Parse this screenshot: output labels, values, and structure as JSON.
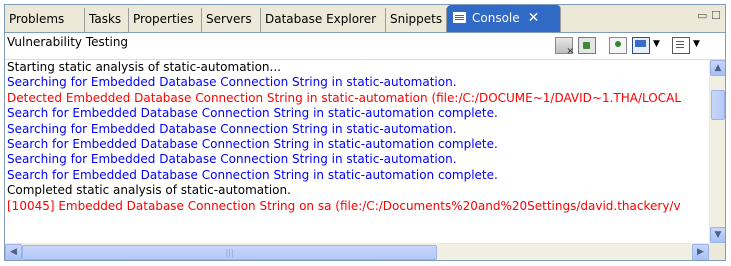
{
  "tabs": [
    {
      "label": "Problems"
    },
    {
      "label": "Tasks"
    },
    {
      "label": "Properties"
    },
    {
      "label": "Servers"
    },
    {
      "label": "Database Explorer"
    },
    {
      "label": "Snippets"
    },
    {
      "label": "Console",
      "active": true
    }
  ],
  "window_controls": {
    "minimize": "▭",
    "maximize": "☐"
  },
  "console_title": "Vulnerability Testing",
  "toolbar_icons": [
    "clear-console-icon",
    "scroll-lock-icon",
    "pin-console-icon",
    "display-console-icon",
    "open-console-icon"
  ],
  "colors": {
    "normal": "#000000",
    "info": "#0000ff",
    "error": "#ff0000",
    "accent": "#3169c6"
  },
  "lines": [
    {
      "text": "Starting static analysis of static-automation...",
      "color": "black"
    },
    {
      "text": "Searching for Embedded Database Connection String in static-automation.",
      "color": "blue"
    },
    {
      "text": "Detected Embedded Database Connection String in static-automation (file:/C:/DOCUME~1/DAVID~1.THA/LOCAL",
      "color": "red"
    },
    {
      "text": "Search for Embedded Database Connection String in static-automation complete.",
      "color": "blue"
    },
    {
      "text": "Searching for Embedded Database Connection String in static-automation.",
      "color": "blue"
    },
    {
      "text": "Search for Embedded Database Connection String in static-automation complete.",
      "color": "blue"
    },
    {
      "text": "Searching for Embedded Database Connection String in static-automation.",
      "color": "blue"
    },
    {
      "text": "Search for Embedded Database Connection String in static-automation complete.",
      "color": "blue"
    },
    {
      "text": "Completed static analysis of static-automation.",
      "color": "black"
    },
    {
      "text": "[10045] Embedded Database Connection String on sa (file:/C:/Documents%20and%20Settings/david.thackery/v",
      "color": "red"
    }
  ]
}
